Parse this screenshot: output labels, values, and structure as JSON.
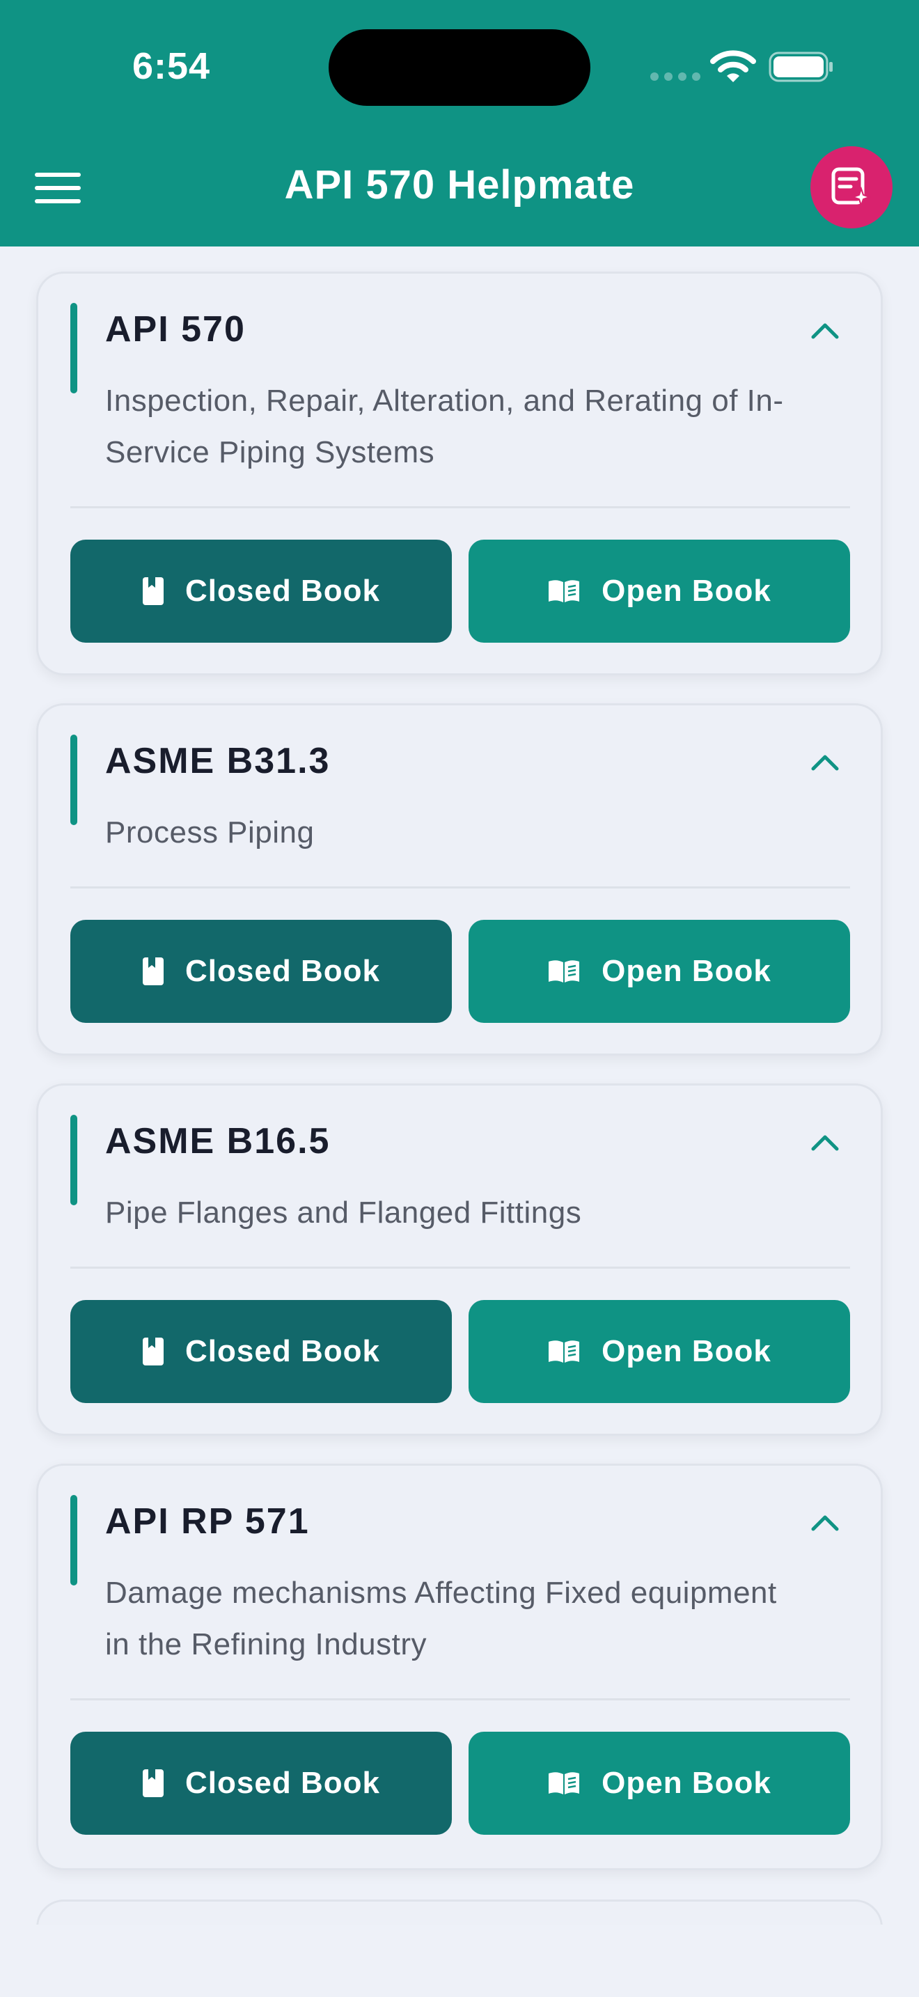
{
  "status_bar": {
    "time": "6:54"
  },
  "header": {
    "title": "API 570 Helpmate"
  },
  "colors": {
    "brand": "#0f9384",
    "closed_book_button": "#12686a",
    "open_book_button": "#0f9384",
    "ai_button": "#d9226e",
    "background": "#eef1f8"
  },
  "icons": {
    "menu": "hamburger-menu-icon",
    "ai": "document-sparkle-icon",
    "collapse": "chevron-up-icon",
    "closed_book": "closed-book-icon",
    "open_book": "open-book-icon"
  },
  "cards": [
    {
      "title": "API 570",
      "description": "Inspection, Repair, Alteration, and Rerating of In-Service Piping Systems",
      "closed_label": "Closed Book",
      "open_label": "Open Book"
    },
    {
      "title": "ASME B31.3",
      "description": "Process Piping",
      "closed_label": "Closed Book",
      "open_label": "Open Book"
    },
    {
      "title": "ASME B16.5",
      "description": "Pipe Flanges and Flanged Fittings",
      "closed_label": "Closed Book",
      "open_label": "Open Book"
    },
    {
      "title": "API RP 571",
      "description": "Damage mechanisms Affecting Fixed equipment in the Refining Industry",
      "closed_label": "Closed Book",
      "open_label": "Open Book"
    }
  ]
}
